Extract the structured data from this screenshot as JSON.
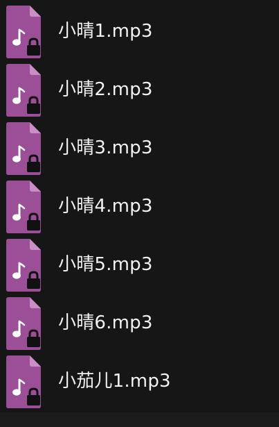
{
  "files": [
    {
      "name": "小晴1.mp3",
      "icon": "locked-audio-file-icon"
    },
    {
      "name": "小晴2.mp3",
      "icon": "locked-audio-file-icon"
    },
    {
      "name": "小晴3.mp3",
      "icon": "locked-audio-file-icon"
    },
    {
      "name": "小晴4.mp3",
      "icon": "locked-audio-file-icon"
    },
    {
      "name": "小晴5.mp3",
      "icon": "locked-audio-file-icon"
    },
    {
      "name": "小晴6.mp3",
      "icon": "locked-audio-file-icon"
    },
    {
      "name": "小茄儿1.mp3",
      "icon": "locked-audio-file-icon"
    }
  ],
  "colors": {
    "background": "#161617",
    "icon_body": "#9a4f96",
    "icon_fold": "#c98ec5",
    "text": "#f2f2f2",
    "lock": "#111111"
  }
}
